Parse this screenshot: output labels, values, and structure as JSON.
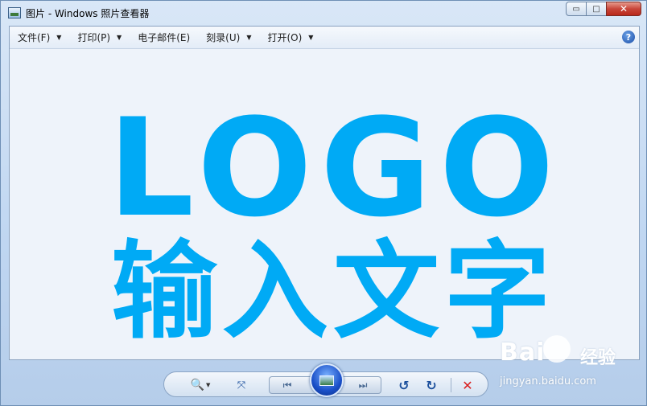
{
  "window": {
    "title": "图片 - Windows 照片查看器",
    "controls": {
      "minimize": "▭",
      "maximize": "□",
      "close": "✕"
    }
  },
  "menubar": {
    "items": [
      {
        "label": "文件(F)",
        "has_dropdown": true
      },
      {
        "label": "打印(P)",
        "has_dropdown": true
      },
      {
        "label": "电子邮件(E)",
        "has_dropdown": false
      },
      {
        "label": "刻录(U)",
        "has_dropdown": true
      },
      {
        "label": "打开(O)",
        "has_dropdown": true
      }
    ],
    "help_icon": "?"
  },
  "image": {
    "line1": "LOGO",
    "line2": "输入文字",
    "color": "#00aaf5"
  },
  "toolbar": {
    "zoom_icon": "🔍",
    "fit_icon": "⤧",
    "prev_icon": "⏮",
    "next_icon": "⏭",
    "rotate_left_icon": "↺",
    "rotate_right_icon": "↻",
    "delete_icon": "✕"
  },
  "watermark": {
    "brand": "Bai",
    "suffix": "经验",
    "url": "jingyan.baidu.com"
  }
}
